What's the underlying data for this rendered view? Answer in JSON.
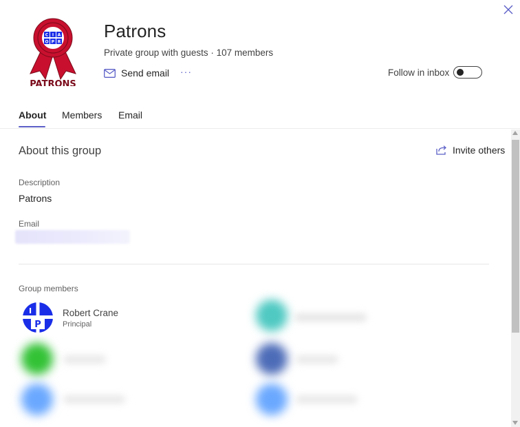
{
  "header": {
    "title": "Patrons",
    "subtitle": "Private group with guests · 107 members",
    "send_email_label": "Send email",
    "more_label": "···",
    "follow_label": "Follow in inbox",
    "follow_enabled": false,
    "logo_text": "PATRONS",
    "logo_badge_letters": "CIA OPR"
  },
  "tabs": [
    {
      "label": "About",
      "active": true
    },
    {
      "label": "Members",
      "active": false
    },
    {
      "label": "Email",
      "active": false
    }
  ],
  "about": {
    "section_title": "About this group",
    "invite_label": "Invite others",
    "description_label": "Description",
    "description_value": "Patrons",
    "email_label": "Email",
    "email_value_blurred": true
  },
  "members": {
    "label": "Group members",
    "items": [
      {
        "name": "Robert Crane",
        "role": "Principal",
        "avatar_letters": "IP",
        "avatar_color": "#1a2ee8"
      }
    ],
    "blurred_avatar_colors": [
      "#4fc9c2",
      "#33c236",
      "#4d6cb8",
      "#6aa8ff",
      "#6aa8ff"
    ]
  },
  "colors": {
    "accent": "#5b5fc7",
    "text": "#242424",
    "logo_red": "#c8102e"
  }
}
